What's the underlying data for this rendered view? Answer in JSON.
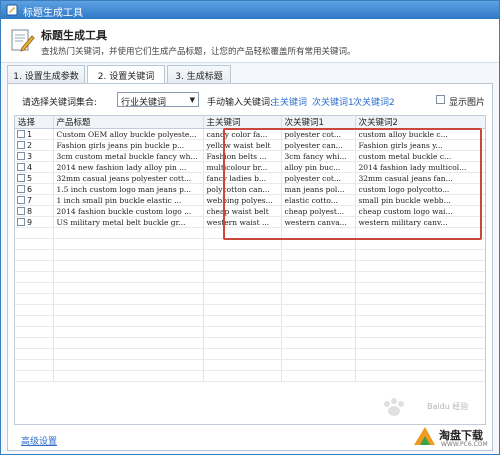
{
  "window": {
    "title": "标题生成工具"
  },
  "header": {
    "title": "标题生成工具",
    "description": "查找热门关键词，并使用它们生成产品标题，让您的产品轻松覆盖所有常用关键词。"
  },
  "tabs": [
    {
      "label": "1. 设置生成参数",
      "active": false
    },
    {
      "label": "2. 设置关键词",
      "active": true
    },
    {
      "label": "3. 生成标题",
      "active": false
    }
  ],
  "toolbar": {
    "collection_label": "请选择关键词集合:",
    "collection_value": "行业关键词",
    "manual_label": "手动输入关键词:",
    "link_main": "主关键词",
    "link_sec1": "次关键词1",
    "link_sec2": "次关键词2",
    "show_image_label": "显示图片"
  },
  "grid": {
    "columns": [
      "选择",
      "产品标题",
      "主关键词",
      "次关键词1",
      "次关键词2"
    ],
    "rows": [
      {
        "num": "1",
        "title": "Custom OEM alloy buckle polyeste...",
        "main": "candy color fa...",
        "sec1": "polyester cot...",
        "sec2": "custom alloy buckle c..."
      },
      {
        "num": "2",
        "title": "Fashion girls jeans pin buckle p...",
        "main": "yellow waist belt",
        "sec1": "polyester can...",
        "sec2": "Fashion girls jeans y..."
      },
      {
        "num": "3",
        "title": "3cm custom metal buckle fancy wh...",
        "main": "Fashion belts ...",
        "sec1": "3cm fancy whi...",
        "sec2": "custom metal buckle c..."
      },
      {
        "num": "4",
        "title": "2014 new fashion lady alloy pin ...",
        "main": "multicolour br...",
        "sec1": "alloy pin buc...",
        "sec2": "2014 fashion lady multicol..."
      },
      {
        "num": "5",
        "title": "32mm casual jeans polyester cott...",
        "main": "fancy ladies b...",
        "sec1": "polyester cot...",
        "sec2": "32mm casual jeans fan..."
      },
      {
        "num": "6",
        "title": "1.5 inch custom logo man jeans p...",
        "main": "polycotton can...",
        "sec1": "man jeans pol...",
        "sec2": "custom logo polycotto..."
      },
      {
        "num": "7",
        "title": "1 inch small pin buckle elastic ...",
        "main": "webbing polyes...",
        "sec1": "elastic cotto...",
        "sec2": "small pin buckle webb..."
      },
      {
        "num": "8",
        "title": "2014 fashion buckle custom logo ...",
        "main": "cheap waist belt",
        "sec1": "cheap polyest...",
        "sec2": "cheap custom logo wai..."
      },
      {
        "num": "9",
        "title": "US military metal belt buckle gr...",
        "main": "western waist ...",
        "sec1": "western canva...",
        "sec2": "western military canv..."
      }
    ],
    "empty_rows": 14
  },
  "footer": {
    "advanced_link": "高级设置"
  },
  "watermark": {
    "text": "Baidu 经验"
  },
  "logo": {
    "text": "淘盘下载",
    "sub": "WWW.PC6.COM"
  },
  "colors": {
    "titlebar": "#3a80cc",
    "link": "#2b6ccd",
    "highlight": "#c9473b"
  }
}
